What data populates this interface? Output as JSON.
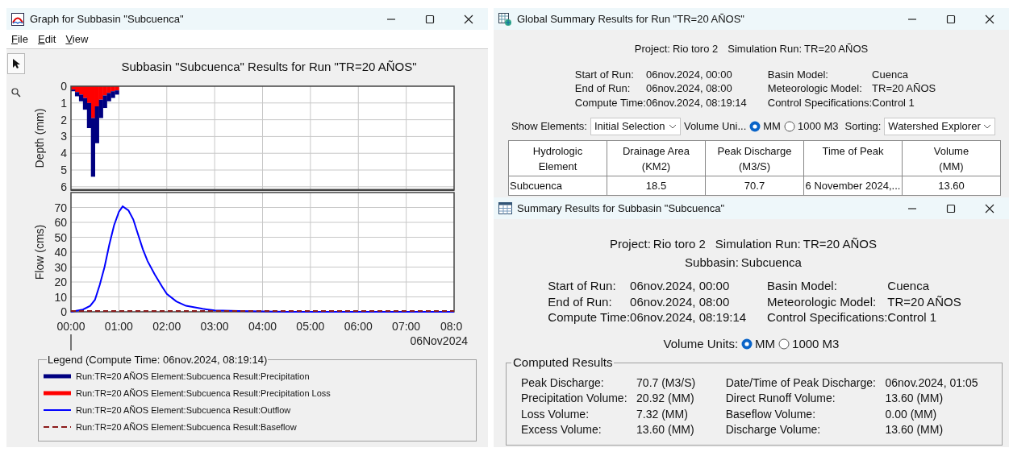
{
  "graph_window": {
    "title": "Graph for Subbasin \"Subcuenca\"",
    "menu": [
      "File",
      "Edit",
      "View"
    ],
    "tools": [
      {
        "kind": "pointer",
        "selected": true
      },
      {
        "kind": "zoom",
        "selected": false
      }
    ],
    "chart_title": "Subbasin \"Subcuenca\" Results for Run \"TR=20 AÑOS\"",
    "depth_chart": {
      "chart_data": {
        "type": "bar",
        "ylabel": "Depth (mm)",
        "x": [
          0,
          0.0833,
          0.1667,
          0.25,
          0.3333,
          0.4167,
          0.5,
          0.5833,
          0.6667,
          0.75,
          0.8333,
          0.9167
        ],
        "xlim": [
          0,
          8
        ],
        "ylim": [
          6.2,
          0
        ],
        "yticks": [
          0,
          1,
          2,
          3,
          4,
          5,
          6
        ],
        "stacked": true,
        "grid": true,
        "series": [
          {
            "color": "#ff0000",
            "values": [
              0.2,
              0.35,
              0.5,
              0.7,
              1.0,
              1.9,
              1.2,
              0.8,
              0.55,
              0.4,
              0.3,
              0.25
            ]
          },
          {
            "color": "#000080",
            "values": [
              0.1,
              0.25,
              0.4,
              0.7,
              1.5,
              3.5,
              2.2,
              1.1,
              0.75,
              0.5,
              0.4,
              0.25
            ]
          }
        ]
      }
    },
    "flow_chart": {
      "chart_data": {
        "type": "line",
        "ylabel": "Flow (cms)",
        "grid": true,
        "x": [
          0,
          0.25,
          0.4,
          0.5,
          0.6,
          0.7,
          0.8,
          0.9,
          1.0,
          1.08,
          1.2,
          1.3,
          1.4,
          1.5,
          1.6,
          1.75,
          1.9,
          2.0,
          2.2,
          2.4,
          2.75,
          3.0,
          3.5,
          4.0,
          4.5,
          8
        ],
        "xlim": [
          0,
          8
        ],
        "ylim": [
          0,
          80
        ],
        "yticks": [
          0,
          10,
          20,
          30,
          40,
          50,
          60,
          70
        ],
        "xticks": [
          {
            "value": 0,
            "label": "00:00"
          },
          {
            "value": 1,
            "label": "01:00"
          },
          {
            "value": 2,
            "label": "02:00"
          },
          {
            "value": 3,
            "label": "03:00"
          },
          {
            "value": 4,
            "label": "04:00"
          },
          {
            "value": 5,
            "label": "05:00"
          },
          {
            "value": 6,
            "label": "06:00"
          },
          {
            "value": 7,
            "label": "07:00"
          },
          {
            "value": 8,
            "label": "08:0"
          }
        ],
        "series": [
          {
            "color": "#0000ff",
            "line_style": "solid",
            "values": [
              0,
              1.5,
              4,
              8,
              18,
              30,
              45,
              58,
              67,
              70.7,
              68,
              62,
              52,
              42,
              34,
              25,
              17,
              12,
              7,
              4,
              2,
              1,
              0.5,
              0.3,
              0,
              0
            ]
          },
          {
            "color": "#8b1a1a",
            "line_style": "dashed",
            "values": [
              0,
              0,
              0,
              0,
              0,
              0,
              0,
              0,
              0,
              0,
              0,
              0,
              0,
              0,
              0,
              0,
              0,
              0,
              0,
              0,
              0,
              0,
              0,
              0,
              0,
              0
            ]
          }
        ]
      }
    },
    "date_label": "06Nov2024",
    "legend": {
      "title": "Legend (Compute Time: 06nov.2024, 08:19:14)",
      "items": [
        {
          "label": "Run:TR=20 AÑOS Element:Subcuenca Result:Precipitation",
          "color": "#000080",
          "kind": "thick"
        },
        {
          "label": "Run:TR=20 AÑOS Element:Subcuenca Result:Precipitation Loss",
          "color": "#ff0000",
          "kind": "thick"
        },
        {
          "label": "Run:TR=20 AÑOS Element:Subcuenca Result:Outflow",
          "color": "#0000ff",
          "kind": "thin"
        },
        {
          "label": "Run:TR=20 AÑOS Element:Subcuenca Result:Baseflow",
          "color": "#8b1a1a",
          "kind": "dashed"
        }
      ]
    }
  },
  "global_summary": {
    "title": "Global Summary Results for Run \"TR=20 AÑOS\"",
    "project_label": "Project:",
    "project": "Rio toro 2",
    "run_label": "Simulation Run:",
    "run": "TR=20 AÑOS",
    "info": [
      {
        "label": "Start of Run:",
        "value": "06nov.2024, 00:00"
      },
      {
        "label": "Basin Model:",
        "value": "Cuenca"
      },
      {
        "label": "End of Run:",
        "value": "06nov.2024, 08:00"
      },
      {
        "label": "Meteorologic Model:",
        "value": "TR=20 AÑOS"
      },
      {
        "label": "Compute Time:",
        "value": "06nov.2024, 08:19:14"
      },
      {
        "label": "Control Specifications:",
        "value": "Control 1"
      }
    ],
    "show_elements": {
      "label": "Show Elements:",
      "value": "Initial Selection"
    },
    "volume_units": {
      "label": "Volume Uni...",
      "options": [
        {
          "label": "MM",
          "selected": true
        },
        {
          "label": "1000 M3",
          "selected": false
        }
      ]
    },
    "sorting": {
      "label": "Sorting:",
      "value": "Watershed Explorer"
    },
    "table": {
      "columns": [
        {
          "lines": [
            "Hydrologic",
            "Element"
          ]
        },
        {
          "lines": [
            "Drainage Area",
            "(KM2)"
          ]
        },
        {
          "lines": [
            "Peak Discharge",
            "(M3/S)"
          ]
        },
        {
          "lines": [
            "Time of Peak"
          ]
        },
        {
          "lines": [
            "Volume",
            "(MM)"
          ]
        }
      ],
      "rows": [
        [
          "Subcuenca",
          "18.5",
          "70.7",
          "6 November 2024,...",
          "13.60"
        ]
      ]
    }
  },
  "subbasin_summary": {
    "title": "Summary Results for Subbasin \"Subcuenca\"",
    "project_label": "Project:",
    "project": "Rio toro 2",
    "run_label": "Simulation Run:",
    "run": "TR=20 AÑOS",
    "subbasin_label": "Subbasin:",
    "subbasin": "Subcuenca",
    "info": [
      {
        "label": "Start of Run:",
        "value": "06nov.2024, 00:00"
      },
      {
        "label": "Basin Model:",
        "value": "Cuenca"
      },
      {
        "label": "End of Run:",
        "value": "06nov.2024, 08:00"
      },
      {
        "label": "Meteorologic Model:",
        "value": "TR=20 AÑOS"
      },
      {
        "label": "Compute Time:",
        "value": "06nov.2024, 08:19:14"
      },
      {
        "label": "Control Specifications:",
        "value": "Control 1"
      }
    ],
    "volume_units": {
      "label": "Volume Units:",
      "options": [
        {
          "label": "MM",
          "selected": true
        },
        {
          "label": "1000 M3",
          "selected": false
        }
      ]
    },
    "computed_results": {
      "title": "Computed Results",
      "items": [
        {
          "label": "Peak Discharge:",
          "value": "70.7 (M3/S)"
        },
        {
          "label": "Date/Time of Peak Discharge:",
          "value": "06nov.2024, 01:05"
        },
        {
          "label": "Precipitation Volume:",
          "value": "20.92 (MM)"
        },
        {
          "label": "Direct Runoff Volume:",
          "value": "13.60 (MM)"
        },
        {
          "label": "Loss Volume:",
          "value": "7.32 (MM)"
        },
        {
          "label": "Baseflow Volume:",
          "value": "0.00 (MM)"
        },
        {
          "label": "Excess Volume:",
          "value": "13.60 (MM)"
        },
        {
          "label": "Discharge Volume:",
          "value": "13.60 (MM)"
        }
      ]
    }
  }
}
